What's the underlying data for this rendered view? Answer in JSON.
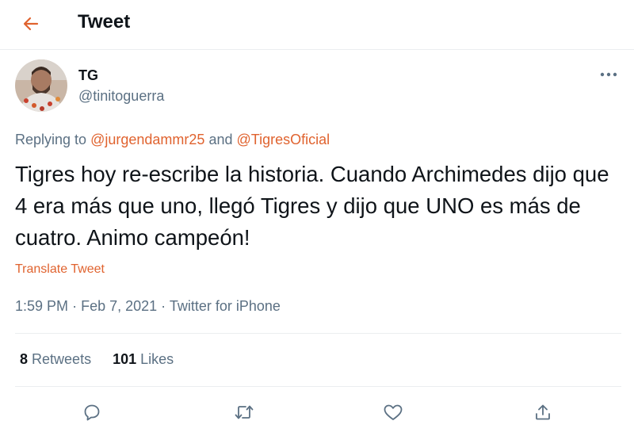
{
  "header": {
    "title": "Tweet",
    "back_icon": "arrow-left-icon"
  },
  "colors": {
    "accent": "#e0632f",
    "secondary_text": "#5b7083",
    "primary_text": "#0f1419",
    "divider": "#ebeef0"
  },
  "author": {
    "name": "TG",
    "handle": "@tinitoguerra"
  },
  "reply": {
    "prefix": "Replying to",
    "user1": "@jurgendammr25",
    "conjunction": "and",
    "user2": "@TigresOficial"
  },
  "tweet": {
    "text": "Tigres hoy re-escribe la historia. Cuando Archimedes dijo que 4 era más que uno, llegó Tigres y dijo que UNO es más de cuatro. Animo campeón!",
    "translate_label": "Translate Tweet",
    "time": "1:59 PM",
    "separator": "·",
    "date": "Feb 7, 2021",
    "source": "Twitter for iPhone"
  },
  "stats": {
    "retweets_count": "8",
    "retweets_label": "Retweets",
    "likes_count": "101",
    "likes_label": "Likes"
  },
  "actions": [
    "reply-icon",
    "retweet-icon",
    "like-icon",
    "share-icon"
  ]
}
